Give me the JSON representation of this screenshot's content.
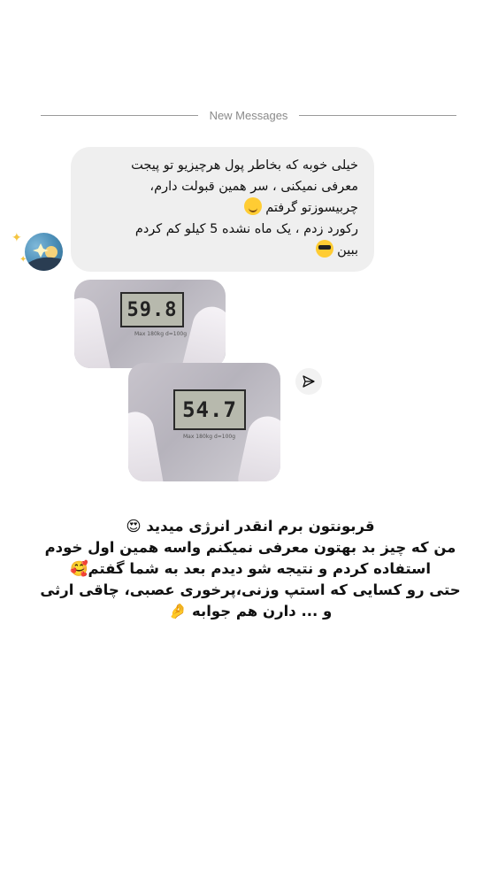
{
  "divider": {
    "label": "New Messages"
  },
  "message": {
    "lines": [
      "خیلی خوبه که بخاطر پول هرچیزیو تو پیجت",
      "معرفی نمیکنی ، سر همین قبولت دارم،",
      "چربیسوزتو گرفتم",
      "رکورد زدم ، یک ماه نشده 5 کیلو کم کردم",
      "ببین"
    ]
  },
  "photos": [
    {
      "reading": "59.8",
      "scale_text": "Max 180kg  d=100g"
    },
    {
      "reading": "54.7",
      "scale_text": "Max 180kg  d=100g"
    }
  ],
  "caption": {
    "lines": [
      "قربونتون برم انقدر انرژی میدید",
      "من که چیز بد بهتون معرفی نمیکنم واسه همین اول خودم",
      "استفاده کردم و نتیجه شو دیدم بعد به شما گفتم",
      "حتی رو کسایی که استپ وزنی،پرخوری عصبی، چاقی ارثی",
      "و ... دارن هم جوابه"
    ]
  },
  "icons": {
    "share": "paper-plane-icon",
    "emoji_1": "relieved-face-emoji",
    "emoji_2": "sunglasses-face-emoji",
    "emoji_3": "heart-eyes-emoji",
    "emoji_4": "smiling-hearts-emoji",
    "emoji_5": "pinched-fingers-emoji"
  },
  "colors": {
    "bubble_bg": "#efefef",
    "divider": "#9a9a9a",
    "text": "#111111"
  }
}
